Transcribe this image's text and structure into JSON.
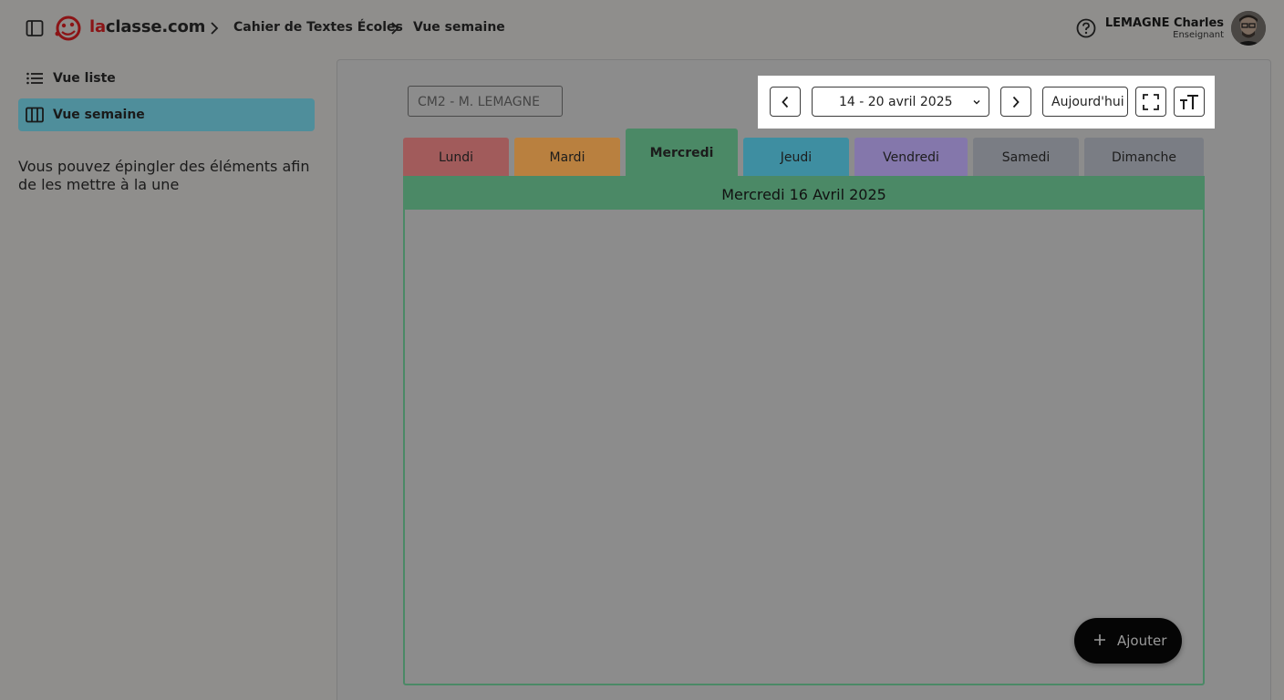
{
  "header": {
    "brand_prefix": "la",
    "brand_rest": "classe.com",
    "breadcrumbs": [
      "Cahier de Textes Écoles",
      "Vue semaine"
    ],
    "user": {
      "name": "LEMAGNE Charles",
      "role": "Enseignant"
    }
  },
  "sidebar": {
    "items": [
      {
        "label": "Vue liste",
        "icon": "list-icon",
        "active": false
      },
      {
        "label": "Vue semaine",
        "icon": "week-columns-icon",
        "active": true
      }
    ],
    "pin_hint": "Vous pouvez épingler des éléments afin de les mettre à la une"
  },
  "main": {
    "class_select": {
      "value": "CM2 - M. LEMAGNE"
    },
    "toolbar": {
      "date_range": "14 - 20 avril 2025",
      "today_label": "Aujourd'hui",
      "prev_icon": "chevron-left-icon",
      "next_icon": "chevron-right-icon",
      "fullscreen_icon": "fullscreen-icon",
      "text_size_icon": "text-size-icon"
    },
    "tabs": [
      {
        "label": "Lundi",
        "color": "#a15b5b",
        "active": false
      },
      {
        "label": "Mardi",
        "color": "#b9803f",
        "active": false
      },
      {
        "label": "Mercredi",
        "color": "#4b8966",
        "active": true
      },
      {
        "label": "Jeudi",
        "color": "#3e8ea1",
        "active": false
      },
      {
        "label": "Vendredi",
        "color": "#8477ab",
        "active": false
      },
      {
        "label": "Samedi",
        "color": "#7a7d84",
        "active": false
      },
      {
        "label": "Dimanche",
        "color": "#7a7d84",
        "active": false
      }
    ],
    "day_header": "Mercredi 16 Avril 2025",
    "add_button": "Ajouter"
  }
}
